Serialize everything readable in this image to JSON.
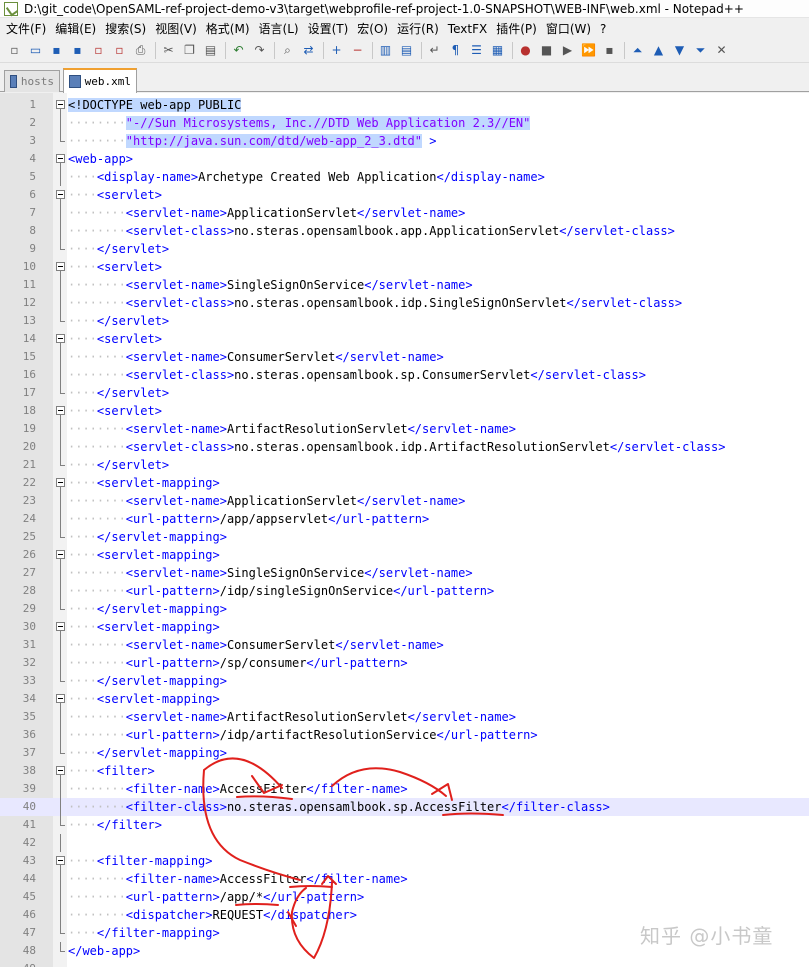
{
  "window": {
    "title": "D:\\git_code\\OpenSAML-ref-project-demo-v3\\target\\webprofile-ref-project-1.0-SNAPSHOT\\WEB-INF\\web.xml - Notepad++"
  },
  "menu": [
    "文件(F)",
    "编辑(E)",
    "搜索(S)",
    "视图(V)",
    "格式(M)",
    "语言(L)",
    "设置(T)",
    "宏(O)",
    "运行(R)",
    "TextFX",
    "插件(P)",
    "窗口(W)",
    "?"
  ],
  "toolbar": {
    "buttons": [
      {
        "name": "new-file-icon",
        "glyph": "▫",
        "cls": "gray"
      },
      {
        "name": "open-file-icon",
        "glyph": "▭",
        "cls": "blue"
      },
      {
        "name": "save-icon",
        "glyph": "▪",
        "cls": "blue"
      },
      {
        "name": "save-all-icon",
        "glyph": "▪",
        "cls": "blue"
      },
      {
        "name": "close-icon",
        "glyph": "▫",
        "cls": "red"
      },
      {
        "name": "close-all-icon",
        "glyph": "▫",
        "cls": "red"
      },
      {
        "name": "print-icon",
        "glyph": "⎙",
        "cls": "gray"
      },
      {
        "sep": true
      },
      {
        "name": "cut-icon",
        "glyph": "✂",
        "cls": "gray"
      },
      {
        "name": "copy-icon",
        "glyph": "❐",
        "cls": "gray"
      },
      {
        "name": "paste-icon",
        "glyph": "▤",
        "cls": "gray"
      },
      {
        "sep": true
      },
      {
        "name": "undo-icon",
        "glyph": "↶",
        "cls": "green"
      },
      {
        "name": "redo-icon",
        "glyph": "↷",
        "cls": "gray"
      },
      {
        "sep": true
      },
      {
        "name": "find-icon",
        "glyph": "⌕",
        "cls": "gray"
      },
      {
        "name": "replace-icon",
        "glyph": "⇄",
        "cls": "blue"
      },
      {
        "sep": true
      },
      {
        "name": "zoom-in-icon",
        "glyph": "+",
        "cls": "blue"
      },
      {
        "name": "zoom-out-icon",
        "glyph": "−",
        "cls": "red"
      },
      {
        "sep": true
      },
      {
        "name": "sync-vertical-icon",
        "glyph": "▥",
        "cls": "blue"
      },
      {
        "name": "sync-horizontal-icon",
        "glyph": "▤",
        "cls": "blue"
      },
      {
        "sep": true
      },
      {
        "name": "word-wrap-icon",
        "glyph": "↵",
        "cls": "gray"
      },
      {
        "name": "show-all-chars-icon",
        "glyph": "¶",
        "cls": "blue"
      },
      {
        "name": "indent-guide-icon",
        "glyph": "☰",
        "cls": "blue"
      },
      {
        "name": "udl-icon",
        "glyph": "▦",
        "cls": "blue"
      },
      {
        "sep": true
      },
      {
        "name": "record-macro-icon",
        "glyph": "●",
        "cls": "red"
      },
      {
        "name": "stop-macro-icon",
        "glyph": "■",
        "cls": "gray"
      },
      {
        "name": "play-macro-icon",
        "glyph": "▶",
        "cls": "gray"
      },
      {
        "name": "run-macro-multiple-icon",
        "glyph": "⏩",
        "cls": "blue"
      },
      {
        "name": "save-macro-icon",
        "glyph": "▪",
        "cls": "gray"
      },
      {
        "sep": true
      },
      {
        "name": "collapse-icon",
        "glyph": "⏶",
        "cls": "blue"
      },
      {
        "name": "move-up-icon",
        "glyph": "▲",
        "cls": "blue"
      },
      {
        "name": "move-down-icon",
        "glyph": "▼",
        "cls": "blue"
      },
      {
        "name": "expand-icon",
        "glyph": "⏷",
        "cls": "blue"
      },
      {
        "name": "mark-icon",
        "glyph": "✕",
        "cls": "gray"
      }
    ]
  },
  "tabs": [
    {
      "label": "hosts",
      "active": false
    },
    {
      "label": "web.xml",
      "active": true
    }
  ],
  "editor": {
    "current_line": 40,
    "lines": [
      {
        "n": "1",
        "fold": "open",
        "segs": [
          [
            "doctype",
            "<!DOCTYPE web-app PUBLIC"
          ]
        ]
      },
      {
        "n": "2",
        "fold": "",
        "segs": [
          [
            "ws",
            "········"
          ],
          [
            "str",
            "\"-//Sun Microsystems, Inc.//DTD Web Application 2.3//EN\""
          ]
        ]
      },
      {
        "n": "3",
        "fold": "end",
        "segs": [
          [
            "ws",
            "········"
          ],
          [
            "str",
            "\"http://java.sun.com/dtd/web-app_2_3.dtd\""
          ],
          [
            "tag",
            " >"
          ]
        ]
      },
      {
        "n": "4",
        "fold": "open",
        "segs": [
          [
            "tag",
            "<web-app>"
          ]
        ]
      },
      {
        "n": "5",
        "fold": "",
        "segs": [
          [
            "ws",
            "····"
          ],
          [
            "tag",
            "<display-name>"
          ],
          [
            "",
            "Archetype Created Web Application"
          ],
          [
            "tag",
            "</display-name>"
          ]
        ]
      },
      {
        "n": "6",
        "fold": "open",
        "segs": [
          [
            "ws",
            "····"
          ],
          [
            "tag",
            "<servlet>"
          ]
        ]
      },
      {
        "n": "7",
        "fold": "",
        "segs": [
          [
            "ws",
            "········"
          ],
          [
            "tag",
            "<servlet-name>"
          ],
          [
            "",
            "ApplicationServlet"
          ],
          [
            "tag",
            "</servlet-name>"
          ]
        ]
      },
      {
        "n": "8",
        "fold": "",
        "segs": [
          [
            "ws",
            "········"
          ],
          [
            "tag",
            "<servlet-class>"
          ],
          [
            "",
            "no.steras.opensamlbook.app.ApplicationServlet"
          ],
          [
            "tag",
            "</servlet-class>"
          ]
        ]
      },
      {
        "n": "9",
        "fold": "end",
        "segs": [
          [
            "ws",
            "····"
          ],
          [
            "tag",
            "</servlet>"
          ]
        ]
      },
      {
        "n": "10",
        "fold": "open",
        "segs": [
          [
            "ws",
            "····"
          ],
          [
            "tag",
            "<servlet>"
          ]
        ]
      },
      {
        "n": "11",
        "fold": "",
        "segs": [
          [
            "ws",
            "········"
          ],
          [
            "tag",
            "<servlet-name>"
          ],
          [
            "",
            "SingleSignOnService"
          ],
          [
            "tag",
            "</servlet-name>"
          ]
        ]
      },
      {
        "n": "12",
        "fold": "",
        "segs": [
          [
            "ws",
            "········"
          ],
          [
            "tag",
            "<servlet-class>"
          ],
          [
            "",
            "no.steras.opensamlbook.idp.SingleSignOnServlet"
          ],
          [
            "tag",
            "</servlet-class>"
          ]
        ]
      },
      {
        "n": "13",
        "fold": "end",
        "segs": [
          [
            "ws",
            "····"
          ],
          [
            "tag",
            "</servlet>"
          ]
        ]
      },
      {
        "n": "14",
        "fold": "open",
        "segs": [
          [
            "ws",
            "····"
          ],
          [
            "tag",
            "<servlet>"
          ]
        ]
      },
      {
        "n": "15",
        "fold": "",
        "segs": [
          [
            "ws",
            "········"
          ],
          [
            "tag",
            "<servlet-name>"
          ],
          [
            "",
            "ConsumerServlet"
          ],
          [
            "tag",
            "</servlet-name>"
          ]
        ]
      },
      {
        "n": "16",
        "fold": "",
        "segs": [
          [
            "ws",
            "········"
          ],
          [
            "tag",
            "<servlet-class>"
          ],
          [
            "",
            "no.steras.opensamlbook.sp.ConsumerServlet"
          ],
          [
            "tag",
            "</servlet-class>"
          ]
        ]
      },
      {
        "n": "17",
        "fold": "end",
        "segs": [
          [
            "ws",
            "····"
          ],
          [
            "tag",
            "</servlet>"
          ]
        ]
      },
      {
        "n": "18",
        "fold": "open",
        "segs": [
          [
            "ws",
            "····"
          ],
          [
            "tag",
            "<servlet>"
          ]
        ]
      },
      {
        "n": "19",
        "fold": "",
        "segs": [
          [
            "ws",
            "········"
          ],
          [
            "tag",
            "<servlet-name>"
          ],
          [
            "",
            "ArtifactResolutionServlet"
          ],
          [
            "tag",
            "</servlet-name>"
          ]
        ]
      },
      {
        "n": "20",
        "fold": "",
        "segs": [
          [
            "ws",
            "········"
          ],
          [
            "tag",
            "<servlet-class>"
          ],
          [
            "",
            "no.steras.opensamlbook.idp.ArtifactResolutionServlet"
          ],
          [
            "tag",
            "</servlet-class>"
          ]
        ]
      },
      {
        "n": "21",
        "fold": "end",
        "segs": [
          [
            "ws",
            "····"
          ],
          [
            "tag",
            "</servlet>"
          ]
        ]
      },
      {
        "n": "22",
        "fold": "open",
        "segs": [
          [
            "ws",
            "····"
          ],
          [
            "tag",
            "<servlet-mapping>"
          ]
        ]
      },
      {
        "n": "23",
        "fold": "",
        "segs": [
          [
            "ws",
            "········"
          ],
          [
            "tag",
            "<servlet-name>"
          ],
          [
            "",
            "ApplicationServlet"
          ],
          [
            "tag",
            "</servlet-name>"
          ]
        ]
      },
      {
        "n": "24",
        "fold": "",
        "segs": [
          [
            "ws",
            "········"
          ],
          [
            "tag",
            "<url-pattern>"
          ],
          [
            "",
            "/app/appservlet"
          ],
          [
            "tag",
            "</url-pattern>"
          ]
        ]
      },
      {
        "n": "25",
        "fold": "end",
        "segs": [
          [
            "ws",
            "····"
          ],
          [
            "tag",
            "</servlet-mapping>"
          ]
        ]
      },
      {
        "n": "26",
        "fold": "open",
        "segs": [
          [
            "ws",
            "····"
          ],
          [
            "tag",
            "<servlet-mapping>"
          ]
        ]
      },
      {
        "n": "27",
        "fold": "",
        "segs": [
          [
            "ws",
            "········"
          ],
          [
            "tag",
            "<servlet-name>"
          ],
          [
            "",
            "SingleSignOnService"
          ],
          [
            "tag",
            "</servlet-name>"
          ]
        ]
      },
      {
        "n": "28",
        "fold": "",
        "segs": [
          [
            "ws",
            "········"
          ],
          [
            "tag",
            "<url-pattern>"
          ],
          [
            "",
            "/idp/singleSignOnService"
          ],
          [
            "tag",
            "</url-pattern>"
          ]
        ]
      },
      {
        "n": "29",
        "fold": "end",
        "segs": [
          [
            "ws",
            "····"
          ],
          [
            "tag",
            "</servlet-mapping>"
          ]
        ]
      },
      {
        "n": "30",
        "fold": "open",
        "segs": [
          [
            "ws",
            "····"
          ],
          [
            "tag",
            "<servlet-mapping>"
          ]
        ]
      },
      {
        "n": "31",
        "fold": "",
        "segs": [
          [
            "ws",
            "········"
          ],
          [
            "tag",
            "<servlet-name>"
          ],
          [
            "",
            "ConsumerServlet"
          ],
          [
            "tag",
            "</servlet-name>"
          ]
        ]
      },
      {
        "n": "32",
        "fold": "",
        "segs": [
          [
            "ws",
            "········"
          ],
          [
            "tag",
            "<url-pattern>"
          ],
          [
            "",
            "/sp/consumer"
          ],
          [
            "tag",
            "</url-pattern>"
          ]
        ]
      },
      {
        "n": "33",
        "fold": "end",
        "segs": [
          [
            "ws",
            "····"
          ],
          [
            "tag",
            "</servlet-mapping>"
          ]
        ]
      },
      {
        "n": "34",
        "fold": "open",
        "segs": [
          [
            "ws",
            "····"
          ],
          [
            "tag",
            "<servlet-mapping>"
          ]
        ]
      },
      {
        "n": "35",
        "fold": "",
        "segs": [
          [
            "ws",
            "········"
          ],
          [
            "tag",
            "<servlet-name>"
          ],
          [
            "",
            "ArtifactResolutionServlet"
          ],
          [
            "tag",
            "</servlet-name>"
          ]
        ]
      },
      {
        "n": "36",
        "fold": "",
        "segs": [
          [
            "ws",
            "········"
          ],
          [
            "tag",
            "<url-pattern>"
          ],
          [
            "",
            "/idp/artifactResolutionService"
          ],
          [
            "tag",
            "</url-pattern>"
          ]
        ]
      },
      {
        "n": "37",
        "fold": "end",
        "segs": [
          [
            "ws",
            "····"
          ],
          [
            "tag",
            "</servlet-mapping>"
          ]
        ]
      },
      {
        "n": "38",
        "fold": "open",
        "segs": [
          [
            "ws",
            "····"
          ],
          [
            "tag",
            "<filter>"
          ]
        ]
      },
      {
        "n": "39",
        "fold": "",
        "segs": [
          [
            "ws",
            "········"
          ],
          [
            "tag",
            "<filter-name>"
          ],
          [
            "",
            "AccessFilter"
          ],
          [
            "tag",
            "</filter-name>"
          ]
        ]
      },
      {
        "n": "40",
        "fold": "",
        "segs": [
          [
            "ws",
            "········"
          ],
          [
            "tag",
            "<filter-class>"
          ],
          [
            "",
            "no.steras.opensamlbook.sp.AccessFilter"
          ],
          [
            "tag",
            "</filter-class>"
          ]
        ]
      },
      {
        "n": "41",
        "fold": "end",
        "segs": [
          [
            "ws",
            "····"
          ],
          [
            "tag",
            "</filter>"
          ]
        ]
      },
      {
        "n": "42",
        "fold": "",
        "segs": []
      },
      {
        "n": "43",
        "fold": "open",
        "segs": [
          [
            "ws",
            "····"
          ],
          [
            "tag",
            "<filter-mapping>"
          ]
        ]
      },
      {
        "n": "44",
        "fold": "",
        "segs": [
          [
            "ws",
            "········"
          ],
          [
            "tag",
            "<filter-name>"
          ],
          [
            "",
            "AccessFilter"
          ],
          [
            "tag",
            "</filter-name>"
          ]
        ]
      },
      {
        "n": "45",
        "fold": "",
        "segs": [
          [
            "ws",
            "········"
          ],
          [
            "tag",
            "<url-pattern>"
          ],
          [
            "",
            "/app/*"
          ],
          [
            "tag",
            "</url-pattern>"
          ]
        ]
      },
      {
        "n": "46",
        "fold": "",
        "segs": [
          [
            "ws",
            "········"
          ],
          [
            "tag",
            "<dispatcher>"
          ],
          [
            "",
            "REQUEST"
          ],
          [
            "tag",
            "</dispatcher>"
          ]
        ]
      },
      {
        "n": "47",
        "fold": "end",
        "segs": [
          [
            "ws",
            "····"
          ],
          [
            "tag",
            "</filter-mapping>"
          ]
        ]
      },
      {
        "n": "48",
        "fold": "end",
        "segs": [
          [
            "tag",
            "</web-app>"
          ]
        ]
      },
      {
        "n": "49",
        "fold": "",
        "segs": []
      }
    ]
  },
  "watermark": "知乎 @小书童",
  "colors": {
    "tag": "#0000ff",
    "string": "#8000ff",
    "annotation": "#e0201c"
  }
}
